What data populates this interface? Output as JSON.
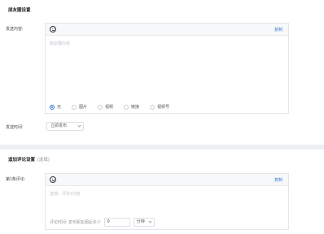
{
  "section1": {
    "title": "朋友圈设置",
    "content_label": "发送内容:",
    "copy_link": "复制",
    "placeholder": "朋友圈内容",
    "attach_options": [
      {
        "label": "无",
        "selected": true
      },
      {
        "label": "图片",
        "selected": false
      },
      {
        "label": "视频",
        "selected": false
      },
      {
        "label": "链接",
        "selected": false
      },
      {
        "label": "视频号",
        "selected": false
      }
    ],
    "send_time_label": "发送时间:",
    "send_time_value": "立即发布"
  },
  "section2": {
    "title": "追加评论设置",
    "hint": "(选填)",
    "comment_label": "第1条评论:",
    "copy_link": "复制",
    "placeholder": "选填，评论1内容",
    "timing_text": "评论时间: 发布朋友圈后多少",
    "timing_value": "0",
    "unit_value": "分钟"
  },
  "colors": {
    "accent": "#2f6fde",
    "link": "#3a7bd5",
    "divider": "#eceef1"
  }
}
